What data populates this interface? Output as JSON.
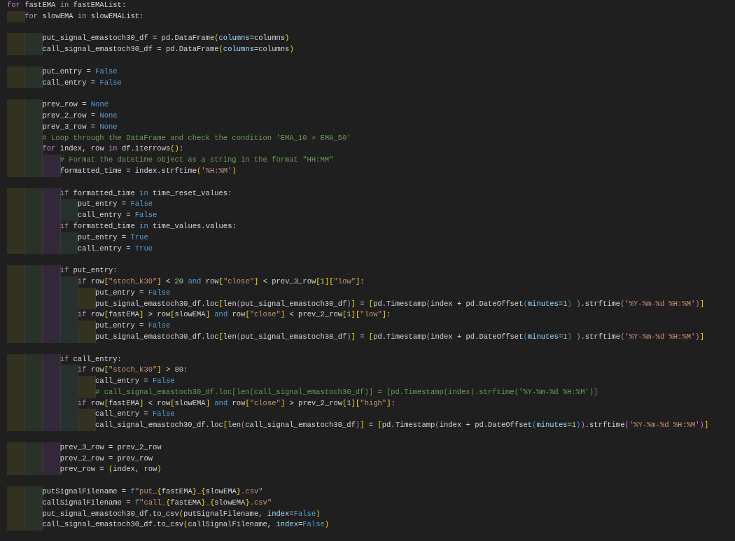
{
  "editor": {
    "lines": [
      {
        "kind": "code",
        "text": "for fastEMA in fastEMAList:"
      },
      {
        "kind": "code",
        "text": "    for slowEMA in slowEMAList:"
      },
      {
        "kind": "blank"
      },
      {
        "kind": "code",
        "text": "        put_signal_emastoch30_df = pd.DataFrame(columns=columns)"
      },
      {
        "kind": "code",
        "text": "        call_signal_emastoch30_df = pd.DataFrame(columns=columns)"
      },
      {
        "kind": "blank"
      },
      {
        "kind": "code",
        "text": "        put_entry = False"
      },
      {
        "kind": "code",
        "text": "        call_entry = False"
      },
      {
        "kind": "blank"
      },
      {
        "kind": "code",
        "text": "        prev_row = None"
      },
      {
        "kind": "code",
        "text": "        prev_2_row = None"
      },
      {
        "kind": "code",
        "text": "        prev_3_row = None"
      },
      {
        "kind": "code",
        "text": "        # Loop through the DataFrame and check the condition 'EMA_10 > EMA_50'"
      },
      {
        "kind": "code",
        "text": "        for index, row in df.iterrows():"
      },
      {
        "kind": "code",
        "text": "            # Format the datetime object as a string in the format \"HH:MM\""
      },
      {
        "kind": "code",
        "text": "            formatted_time = index.strftime('%H:%M')"
      },
      {
        "kind": "blank"
      },
      {
        "kind": "code",
        "text": "            if formatted_time in time_reset_values:"
      },
      {
        "kind": "code",
        "text": "                put_entry = False"
      },
      {
        "kind": "code",
        "text": "                call_entry = False"
      },
      {
        "kind": "code",
        "text": "            if formatted_time in time_values.values:"
      },
      {
        "kind": "code",
        "text": "                put_entry = True"
      },
      {
        "kind": "code",
        "text": "                call_entry = True"
      },
      {
        "kind": "blank"
      },
      {
        "kind": "code",
        "text": "            if put_entry:"
      },
      {
        "kind": "code",
        "text": "                if row[\"stoch_k30\"] < 20 and row[\"close\"] < prev_3_row[1][\"low\"]:"
      },
      {
        "kind": "code",
        "text": "                    put_entry = False"
      },
      {
        "kind": "code",
        "text": "                    put_signal_emastoch30_df.loc[len(put_signal_emastoch30_df)] = [pd.Timestamp(index + pd.DateOffset(minutes=1) ).strftime('%Y-%m-%d %H:%M')]"
      },
      {
        "kind": "code",
        "text": "                if row[fastEMA] > row[slowEMA] and row[\"close\"] < prev_2_row[1][\"low\"]:"
      },
      {
        "kind": "code",
        "text": "                    put_entry = False"
      },
      {
        "kind": "code",
        "text": "                    put_signal_emastoch30_df.loc[len(put_signal_emastoch30_df)] = [pd.Timestamp(index + pd.DateOffset(minutes=1) ).strftime('%Y-%m-%d %H:%M')]"
      },
      {
        "kind": "blank"
      },
      {
        "kind": "code",
        "text": "            if call_entry:"
      },
      {
        "kind": "code",
        "text": "                if row[\"stoch_k30\"] > 80:"
      },
      {
        "kind": "code",
        "text": "                    call_entry = False"
      },
      {
        "kind": "code",
        "text": "                    # call_signal_emastoch30_df.loc[len(call_signal_emastoch30_df)] = [pd.Timestamp(index).strftime('%Y-%m-%d %H:%M')]"
      },
      {
        "kind": "code",
        "text": "                if row[fastEMA] < row[slowEMA] and row[\"close\"] > prev_2_row[1][\"high\"]:"
      },
      {
        "kind": "code",
        "text": "                    call_entry = False"
      },
      {
        "kind": "code",
        "text": "                    call_signal_emastoch30_df.loc[len(call_signal_emastoch30_df)] = [pd.Timestamp(index + pd.DateOffset(minutes=1)).strftime('%Y-%m-%d %H:%M')]"
      },
      {
        "kind": "blank"
      },
      {
        "kind": "code",
        "text": "            prev_3_row = prev_2_row"
      },
      {
        "kind": "code",
        "text": "            prev_2_row = prev_row"
      },
      {
        "kind": "code",
        "text": "            prev_row = (index, row)"
      },
      {
        "kind": "blank"
      },
      {
        "kind": "code",
        "text": "        putSignalFilename = f\"put_{fastEMA}_{slowEMA}.csv\""
      },
      {
        "kind": "code",
        "text": "        callSignalFilename = f\"call_{fastEMA}_{slowEMA}.csv\""
      },
      {
        "kind": "code",
        "text": "        put_signal_emastoch30_df.to_csv(putSignalFilename, index=False)"
      },
      {
        "kind": "code",
        "text": "        call_signal_emastoch30_df.to_csv(callSignalFilename, index=False)"
      }
    ]
  }
}
